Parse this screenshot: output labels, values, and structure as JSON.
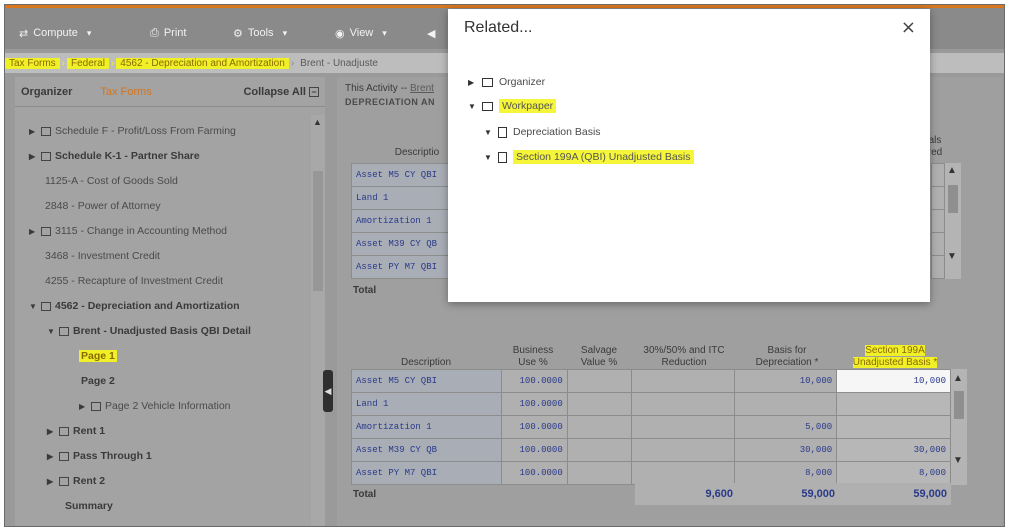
{
  "toolbar": {
    "compute": "Compute",
    "print": "Print",
    "tools": "Tools",
    "view": "View"
  },
  "breadcrumb": [
    "Tax Forms",
    "Federal",
    "4562 - Depreciation and Amortization",
    "Brent - Unadjuste"
  ],
  "left_panel": {
    "organizer_tab": "Organizer",
    "tax_forms_tab": "Tax Forms",
    "collapse_all": "Collapse All",
    "tree": [
      {
        "label": "Schedule F - Profit/Loss From Farming",
        "expanded": false,
        "folder": true,
        "bold": false
      },
      {
        "label": "Schedule K-1 - Partner Share",
        "expanded": false,
        "folder": true,
        "bold": true
      },
      {
        "label": "1125-A - Cost of Goods Sold",
        "folder": false
      },
      {
        "label": "2848 - Power of Attorney",
        "folder": false
      },
      {
        "label": "3115 - Change in Accounting Method",
        "expanded": false,
        "folder": true
      },
      {
        "label": "3468 - Investment Credit",
        "folder": false
      },
      {
        "label": "4255 - Recapture of Investment Credit",
        "folder": false
      },
      {
        "label": "4562 - Depreciation and Amortization",
        "expanded": true,
        "folder": true,
        "bold": true
      },
      {
        "label": "Brent - Unadjusted Basis QBI Detail",
        "expanded": true,
        "folder": true,
        "bold": true
      },
      {
        "label": "Page 1",
        "highlight": true
      },
      {
        "label": "Page 2",
        "bold": true
      },
      {
        "label": "Page 2 Vehicle Information",
        "expanded": false,
        "folder": true
      },
      {
        "label": "Rent 1",
        "expanded": false,
        "folder": true,
        "bold": true
      },
      {
        "label": "Pass Through 1",
        "expanded": false,
        "folder": true,
        "bold": true
      },
      {
        "label": "Rent 2",
        "expanded": false,
        "folder": true,
        "bold": true
      },
      {
        "label": "Summary",
        "bold": true
      }
    ]
  },
  "right_panel": {
    "activity_prefix": "This Activity --",
    "activity_link": "Brent",
    "section_title": "DEPRECIATION AN",
    "upper_table": {
      "description_header": "Descriptio",
      "right_header_1": "als",
      "right_header_2": "red",
      "rows": [
        "Asset M5 CY QBI",
        "Land 1",
        "Amortization 1",
        "Asset M39 CY QB",
        "Asset PY M7 QBI"
      ],
      "total_label": "Total"
    },
    "lower_table": {
      "headers": {
        "description": "Description",
        "business_use": [
          "Business",
          "Use %"
        ],
        "salvage": [
          "Salvage",
          "Value %"
        ],
        "reduction": [
          "30%/50% and ITC",
          "Reduction"
        ],
        "basis": [
          "Basis for",
          "Depreciation *"
        ],
        "section_199a": [
          "Section 199A",
          "Unadjusted Basis *"
        ]
      },
      "rows": [
        {
          "description": "Asset M5 CY QBI",
          "business_use": "100.0000",
          "basis": "10,000",
          "unadjusted": "10,000"
        },
        {
          "description": "Land 1",
          "business_use": "100.0000",
          "basis": "",
          "unadjusted": ""
        },
        {
          "description": "Amortization 1",
          "business_use": "100.0000",
          "basis": "5,000",
          "unadjusted": ""
        },
        {
          "description": "Asset M39 CY QB",
          "business_use": "100.0000",
          "basis": "30,000",
          "unadjusted": "30,000"
        },
        {
          "description": "Asset PY M7 QBI",
          "business_use": "100.0000",
          "basis": "8,000",
          "unadjusted": "8,000"
        }
      ],
      "total_label": "Total",
      "totals": {
        "reduction": "9,600",
        "basis": "59,000",
        "unadjusted": "59,000"
      }
    }
  },
  "modal": {
    "title": "Related...",
    "close": "×",
    "items": [
      {
        "label": "Organizer",
        "expanded": false,
        "type": "folder",
        "highlight": false
      },
      {
        "label": "Workpaper",
        "expanded": true,
        "type": "folder",
        "highlight": true
      },
      {
        "label": "Depreciation Basis",
        "expanded": true,
        "type": "doc",
        "highlight": false
      },
      {
        "label": "Section 199A (QBI) Unadjusted Basis",
        "expanded": true,
        "type": "doc",
        "highlight": true
      }
    ]
  },
  "colors": {
    "highlight": "#f0f028",
    "accent": "#d4751c",
    "link_blue": "#2a3a8a"
  }
}
